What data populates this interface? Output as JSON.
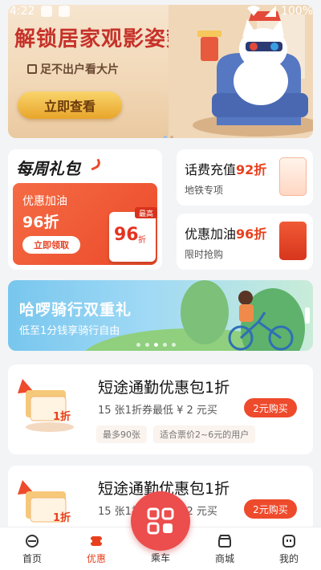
{
  "status_bar": {
    "time": "4:22",
    "battery": "100%"
  },
  "banner": {
    "title": "解锁居家观影姿势",
    "subtitle": "足不出户看大片",
    "button": "立即查看",
    "dots": 3,
    "active_dot": 1
  },
  "weekly_gift": {
    "title": "每周礼包",
    "card_line1": "优惠加油",
    "card_line2": "96折",
    "card_button": "立即领取",
    "coupon_value": "96",
    "coupon_unit": "折",
    "coupon_tag": "最高"
  },
  "promos": [
    {
      "title": "话费充值",
      "discount": "92折",
      "subtitle": "地铁专项"
    },
    {
      "title": "优惠加油",
      "discount": "96折",
      "subtitle": "限时抢购"
    }
  ],
  "ride_banner": {
    "title": "哈啰骑行双重礼",
    "subtitle": "低至1分钱享骑行自由",
    "dots": 5,
    "active_dot": 2
  },
  "commute_packs": [
    {
      "title": "短途通勤优惠包1折",
      "subtitle": "15 张1折券最低 ¥ 2 元买",
      "button": "2元购买",
      "tags": [
        "最多90张",
        "适合票价2~6元的用户"
      ],
      "ticket_text": "1折"
    },
    {
      "title": "短途通勤优惠包1折",
      "subtitle": "15 张1折券最低 ¥ 2 元买",
      "button": "2元购买",
      "tags": [],
      "ticket_text": "1折"
    }
  ],
  "tabbar": {
    "items": [
      {
        "label": "首页",
        "icon": "home-icon"
      },
      {
        "label": "优惠",
        "icon": "coupon-icon"
      },
      {
        "label": "乘车",
        "icon": "qr-code-icon"
      },
      {
        "label": "商城",
        "icon": "store-icon"
      },
      {
        "label": "我的",
        "icon": "profile-icon"
      }
    ],
    "active": "优惠"
  },
  "colors": {
    "accent": "#ec4a2c",
    "fab": "#ec4d4d"
  }
}
